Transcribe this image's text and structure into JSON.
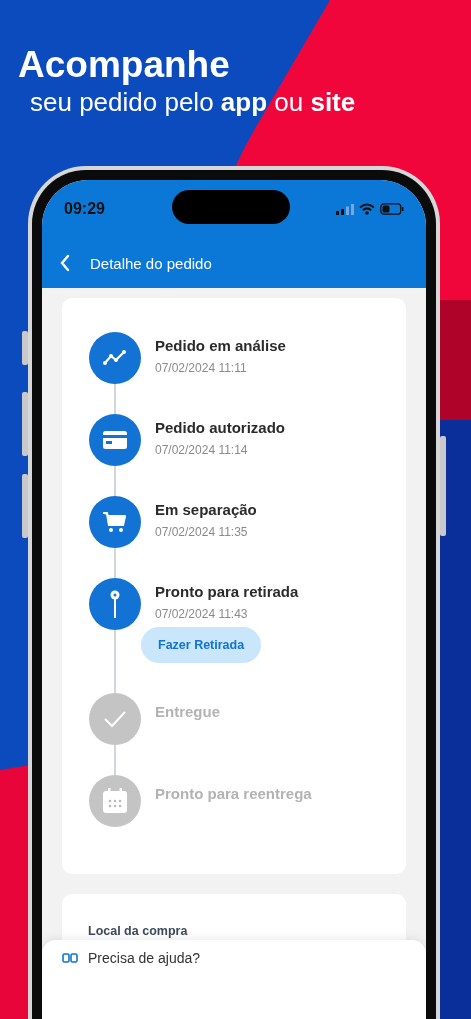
{
  "headline": {
    "title": "Acompanhe",
    "subtitle": "seu pedido pelo **app** ou **site**"
  },
  "status_bar": {
    "time": "09:29"
  },
  "header": {
    "title": "Detalhe do pedido"
  },
  "timeline": [
    {
      "kind": "chart",
      "title": "Pedido em análise",
      "date": "07/02/2024 11:11",
      "done": true
    },
    {
      "kind": "card",
      "title": "Pedido autorizado",
      "date": "07/02/2024 11:14",
      "done": true
    },
    {
      "kind": "cart",
      "title": "Em separação",
      "date": "07/02/2024 11:35",
      "done": true
    },
    {
      "kind": "pin",
      "title": "Pronto para retirada",
      "date": "07/02/2024 11:43",
      "done": true,
      "action": "Fazer Retirada"
    },
    {
      "kind": "check",
      "title": "Entregue",
      "done": false
    },
    {
      "kind": "calendar",
      "title": "Pronto para reentrega",
      "done": false
    }
  ],
  "purchase_section": {
    "title": "Local da compra"
  },
  "help": {
    "label": "Precisa de ajuda?"
  }
}
